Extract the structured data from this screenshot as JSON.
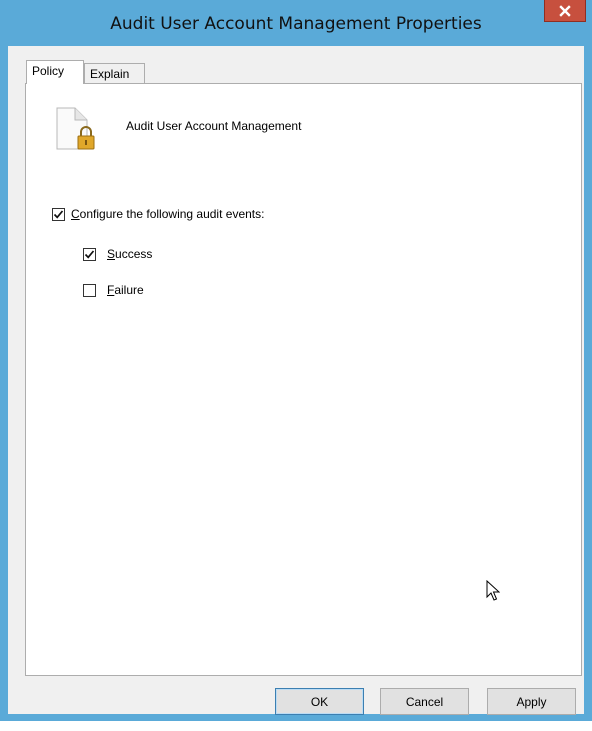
{
  "window": {
    "title": "Audit User Account Management Properties",
    "close_label": "x"
  },
  "tabs": [
    {
      "label": "Policy",
      "active": true
    },
    {
      "label": "Explain",
      "active": false
    }
  ],
  "policy": {
    "icon": "policy-document-lock-icon",
    "name": "Audit User Account Management"
  },
  "configure": {
    "label_prefix": "",
    "label_access": "C",
    "label_rest": "onfigure the following audit events:",
    "checked": true
  },
  "success": {
    "label_access": "S",
    "label_rest": "uccess",
    "checked": true
  },
  "failure": {
    "label_access": "F",
    "label_rest": "ailure",
    "checked": false
  },
  "buttons": {
    "ok": "OK",
    "cancel": "Cancel",
    "apply": "Apply"
  },
  "colors": {
    "title_bar": "#5aaad8",
    "close_button": "#c7503e",
    "dialog_bg": "#f0f0f0"
  }
}
